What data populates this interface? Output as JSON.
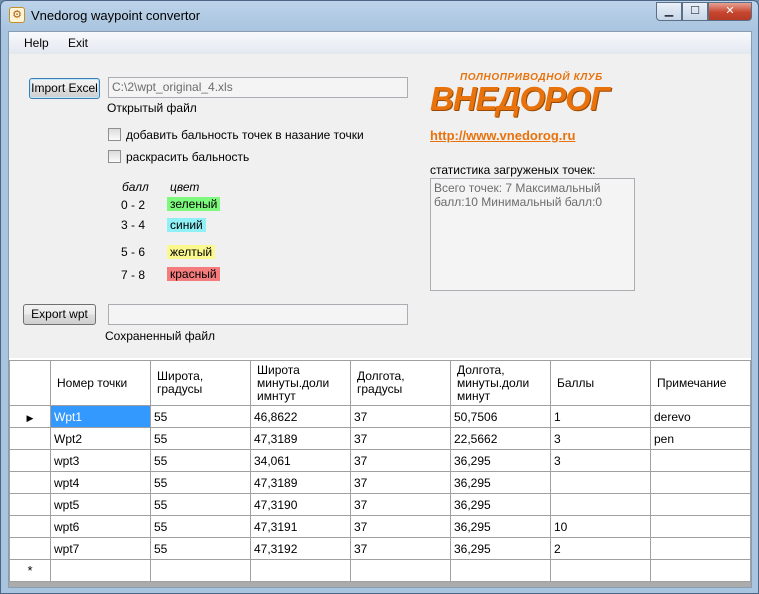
{
  "window": {
    "title": "Vnedorog waypoint convertor"
  },
  "menu": {
    "help": "Help",
    "exit": "Exit"
  },
  "import": {
    "button_label": "Import Excel",
    "file_path": "C:\\2\\wpt_original_4.xls",
    "file_label": "Открытый файл"
  },
  "options": {
    "add_score_label": "добавить бальность точек в назание точки",
    "colorize_label": "раскрасить бальность"
  },
  "legend": {
    "score_header": "балл",
    "color_header": "цвет",
    "items": [
      {
        "range": "0 - 2",
        "color_name": "зеленый",
        "color": "#7dfa7d"
      },
      {
        "range": "3 - 4",
        "color_name": "синий",
        "color": "#8ff0f6"
      },
      {
        "range": "5 - 6",
        "color_name": "желтый",
        "color": "#fbf88e"
      },
      {
        "range": "7 - 8",
        "color_name": "красный",
        "color": "#f47c7c"
      }
    ]
  },
  "export": {
    "button_label": "Export wpt",
    "file_path": "",
    "file_label": "Сохраненный файл"
  },
  "logo": {
    "top_text": "ПОЛНОПРИВОДНОЙ КЛУБ",
    "main_text": "ВНЕДОРОГ"
  },
  "site_link": "http://www.vnedorog.ru",
  "stats": {
    "label": "статистика загруженых точек:",
    "text": "Всего точек: 7 Максимальный балл:10 Минимальный балл:0"
  },
  "grid": {
    "columns": [
      "Номер точки",
      "Широта, градусы",
      "Широта минуты.доли имнтут",
      "Долгота, градусы",
      "Долгота, минуты.доли минут",
      "Баллы",
      "Примечание"
    ],
    "rows": [
      [
        "Wpt1",
        "55",
        "46,8622",
        "37",
        "50,7506",
        "1",
        "derevo"
      ],
      [
        "Wpt2",
        "55",
        "47,3189",
        "37",
        "22,5662",
        "3",
        "pen"
      ],
      [
        "wpt3",
        "55",
        "34,061",
        "37",
        "36,295",
        "3",
        ""
      ],
      [
        "wpt4",
        "55",
        "47,3189",
        "37",
        "36,295",
        "",
        ""
      ],
      [
        "wpt5",
        "55",
        "47,3190",
        "37",
        "36,295",
        "",
        ""
      ],
      [
        "wpt6",
        "55",
        "47,3191",
        "37",
        "36,295",
        "10",
        ""
      ],
      [
        "wpt7",
        "55",
        "47,3192",
        "37",
        "36,295",
        "2",
        ""
      ]
    ],
    "current_row_marker": "▶",
    "new_row_marker": "*"
  }
}
